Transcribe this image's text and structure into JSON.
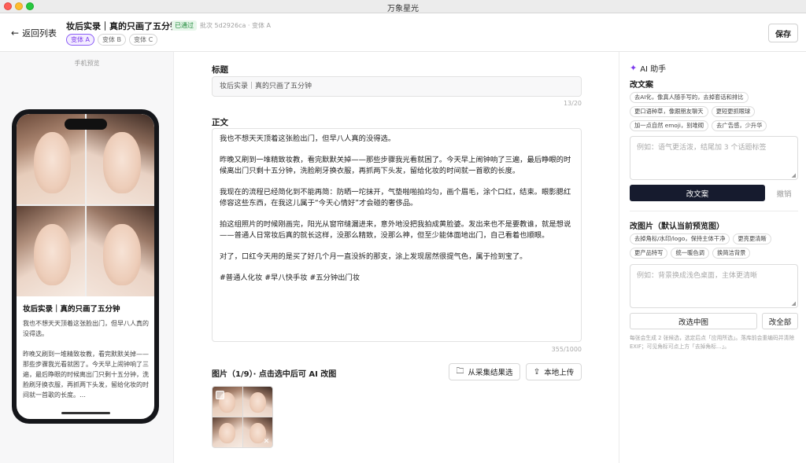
{
  "window": {
    "title": "万象星光"
  },
  "header": {
    "back_label": "返回列表",
    "doc_title": "妆后实录｜真的只画了五分钟",
    "status": "已通过",
    "meta": "批次 5d2926ca · 变体 A",
    "variants": [
      "变体 A",
      "变体 B",
      "变体 C"
    ],
    "save_label": "保存"
  },
  "preview": {
    "label": "手机预览",
    "post_title": "妆后实录｜真的只画了五分钟",
    "post_body": "我也不想天天顶着这张脸出门，但早八人真的没得选。\n\n昨晚又刷到一堆精致妆教，看完默默关掉——那些步骤我光看就困了。今天早上闹钟响了三遍，最后睁眼的时候离出门只剩十五分钟，洗脸刷牙换衣服，再抓两下头发，留给化妆的时间就一首歌的长度。…"
  },
  "editor": {
    "title_label": "标题",
    "title_value": "妆后实录｜真的只画了五分钟",
    "title_count": "13/20",
    "body_label": "正文",
    "body_paragraphs": [
      "我也不想天天顶着这张脸出门，但早八人真的没得选。",
      "昨晚又刷到一堆精致妆教，看完默默关掉——那些步骤我光看就困了。今天早上闹钟响了三遍，最后睁眼的时候离出门只剩十五分钟，洗脸刷牙换衣服，再抓两下头发，留给化妆的时间就一首歌的长度。",
      "我现在的流程已经简化到不能再简：防晒一坨抹开，气垫啪啪拍均匀，画个眉毛，涂个口红，结束。眼影腮红修容这些东西，在我这儿属于“今天心情好”才会碰的奢侈品。",
      "拍这组照片的时候刚画完，阳光从窗帘缝漏进来，意外地没把我拍成黄脸婆。发出来也不是要教谁，就是想说——普通人日常妆后真的就长这样，没那么精致，没那么神，但至少能体面地出门，自己看着也顺眼。",
      "对了，口红今天用的是买了好几个月一直没拆的那支，涂上发现居然很提气色，属于捡到宝了。",
      "#普通人化妆 #早八快手妆 #五分钟出门妆"
    ],
    "body_count": "355/1000",
    "images_label": "图片（1/9）· 点击选中后可 AI 改图",
    "from_collection_label": "从采集结果选",
    "upload_label": "本地上传"
  },
  "ai": {
    "title": "AI 助手",
    "rewrite_label": "改文案",
    "rewrite_chips": [
      "去AI化，像真人随手写的，去掉套话和排比",
      "更口语种草，像跟朋友聊天",
      "更短更抓眼球",
      "加一点自然 emoji，别堆砌",
      "去广告感，少升华"
    ],
    "rewrite_placeholder": "例如：语气更活泼，结尾加 3 个话题标签",
    "rewrite_button": "改文案",
    "undo_button": "撤销",
    "image_label": "改图片（默认当前预览图）",
    "image_chips": [
      "去掉角标/水印/logo，保持主体干净",
      "更亮更清晰",
      "更产品特写",
      "统一暖色调",
      "换简洁背景"
    ],
    "image_placeholder": "例如：背景换成浅色桌面，主体更清晰",
    "edit_selected_button": "改选中图",
    "edit_all_button": "改全部",
    "hint": "每张会生成 2 张候选，选定后点「应用所选」。落库前会重编码并清除 EXIF；可见角标可点上方「去掉角标…」。"
  },
  "colors": {
    "accent": "#7c3aed",
    "primary_button": "#161b2e",
    "status_green": "#1f8a3a"
  }
}
